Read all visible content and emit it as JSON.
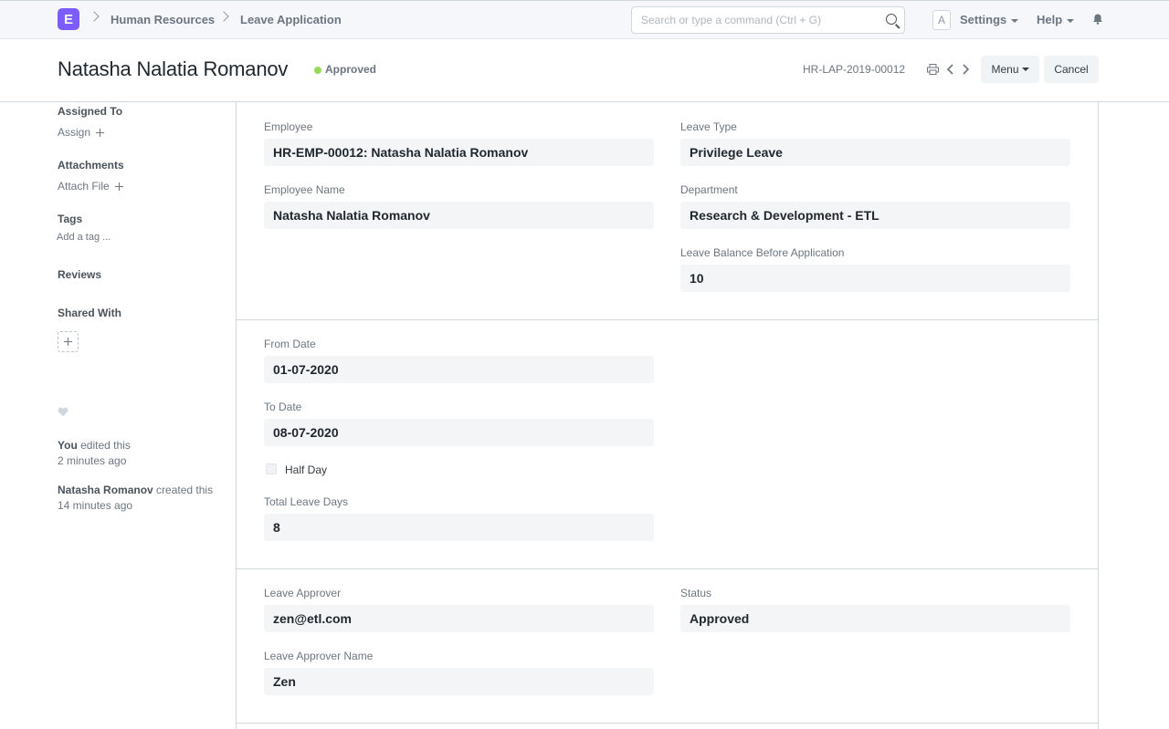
{
  "navbar": {
    "logo_letter": "E",
    "breadcrumbs": [
      "Human Resources",
      "Leave Application"
    ],
    "search_placeholder": "Search or type a command (Ctrl + G)",
    "avatar_letter": "A",
    "settings_label": "Settings",
    "help_label": "Help"
  },
  "header": {
    "title": "Natasha Nalatia Romanov",
    "status": "Approved",
    "status_color": "#98d85b",
    "doc_id": "HR-LAP-2019-00012",
    "menu_label": "Menu",
    "cancel_label": "Cancel"
  },
  "sidebar": {
    "assigned_to": "Assigned To",
    "assign": "Assign",
    "attachments": "Attachments",
    "attach_file": "Attach File",
    "tags": "Tags",
    "add_tag": "Add a tag ...",
    "reviews": "Reviews",
    "shared_with": "Shared With",
    "activity": [
      {
        "user": "You",
        "action": "edited this",
        "time": "2 minutes ago"
      },
      {
        "user": "Natasha Romanov",
        "action": "created this",
        "time": "14 minutes ago"
      }
    ]
  },
  "form": {
    "employee": {
      "label": "Employee",
      "value": "HR-EMP-00012: Natasha Nalatia Romanov"
    },
    "employee_name": {
      "label": "Employee Name",
      "value": "Natasha Nalatia Romanov"
    },
    "leave_type": {
      "label": "Leave Type",
      "value": "Privilege Leave"
    },
    "department": {
      "label": "Department",
      "value": "Research & Development - ETL"
    },
    "leave_balance": {
      "label": "Leave Balance Before Application",
      "value": "10"
    },
    "from_date": {
      "label": "From Date",
      "value": "01-07-2020"
    },
    "to_date": {
      "label": "To Date",
      "value": "08-07-2020"
    },
    "half_day": {
      "label": "Half Day"
    },
    "total_leave_days": {
      "label": "Total Leave Days",
      "value": "8"
    },
    "leave_approver": {
      "label": "Leave Approver",
      "value": "zen@etl.com"
    },
    "status": {
      "label": "Status",
      "value": "Approved"
    },
    "leave_approver_name": {
      "label": "Leave Approver Name",
      "value": "Zen"
    }
  }
}
